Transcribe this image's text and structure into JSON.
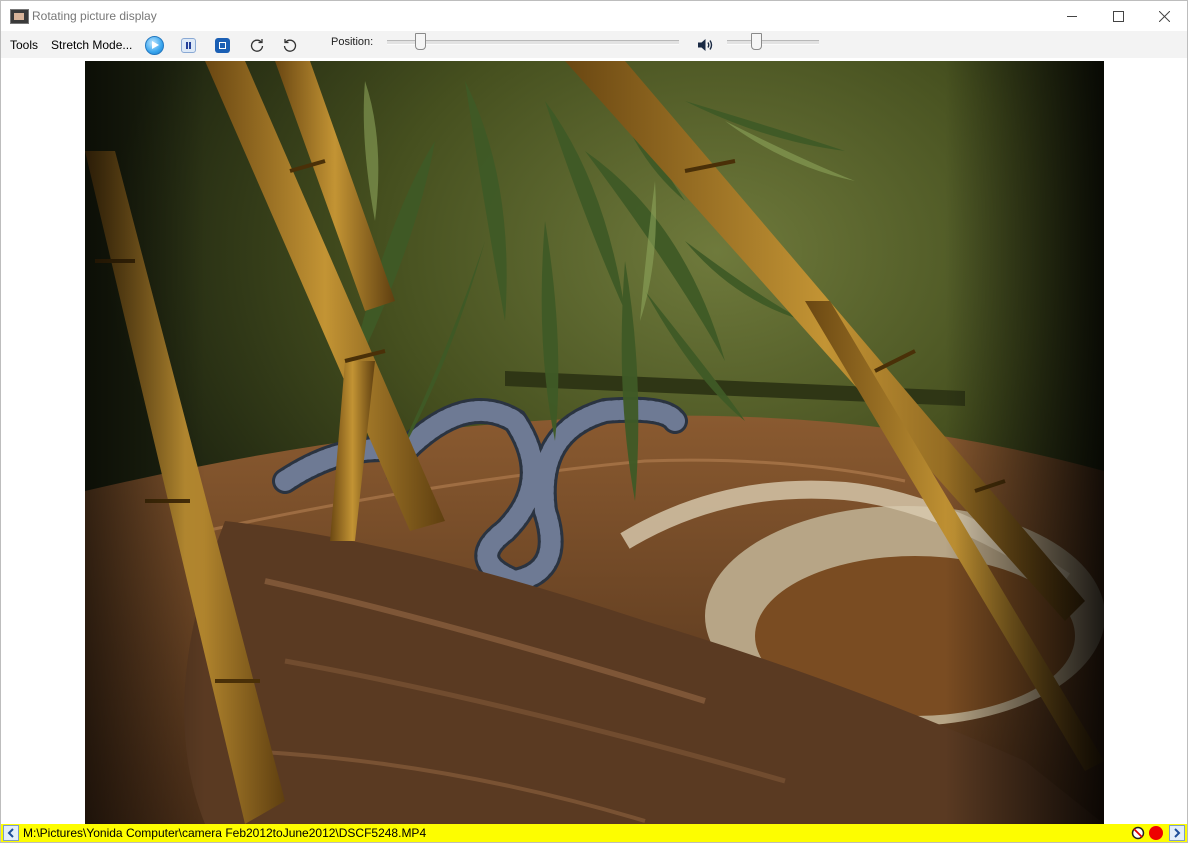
{
  "window": {
    "title": "Rotating picture display"
  },
  "menu": {
    "tools_label": "Tools",
    "stretch_label": "Stretch Mode..."
  },
  "toolbar": {
    "play_icon": "play-icon",
    "pause_icon": "pause-icon",
    "stop_icon": "stop-icon",
    "rotate_cw_icon": "rotate-clockwise-icon",
    "rotate_ccw_icon": "rotate-counterclockwise-icon",
    "position_label": "Position:",
    "position_fraction": 0.1,
    "volume_icon": "speaker-icon",
    "volume_fraction": 0.3
  },
  "video": {
    "content": "terrarium-snake-video-frame"
  },
  "statusbar": {
    "file_path": "M:\\Pictures\\Yonida Computer\\camera Feb2012toJune2012\\DSCF5248.MP4",
    "prev_icon": "chevron-left-icon",
    "next_icon": "chevron-right-icon",
    "no_icon": "prohibited-icon",
    "record_icon": "record-icon",
    "background_color": "#fdfd00",
    "record_color": "#ee0000"
  }
}
